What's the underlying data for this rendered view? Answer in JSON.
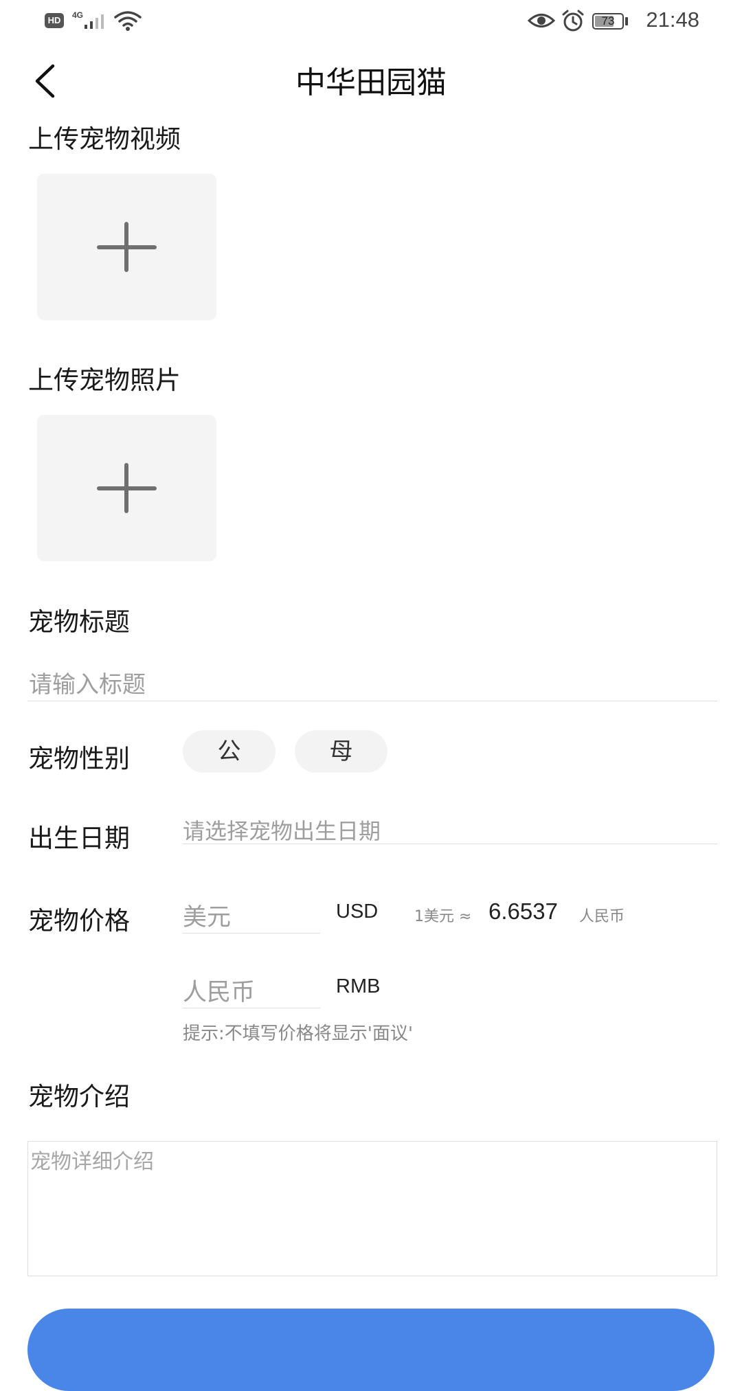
{
  "status_bar": {
    "hd": "HD",
    "network": "4G",
    "battery": "73",
    "battery_level": 0.73,
    "time": "21:48",
    "icons": [
      "hd-icon",
      "signal-icon",
      "wifi-icon",
      "eye-icon",
      "alarm-icon",
      "battery-icon"
    ]
  },
  "header": {
    "title": "中华田园猫",
    "back_icon": "chevron-left-icon"
  },
  "video_section": {
    "label": "上传宠物视频",
    "add_icon": "plus-icon"
  },
  "photo_section": {
    "label": "上传宠物照片",
    "add_icon": "plus-icon"
  },
  "title_field": {
    "label": "宠物标题",
    "placeholder": "请输入标题"
  },
  "gender": {
    "label": "宠物性别",
    "options": [
      "公",
      "母"
    ]
  },
  "birthday": {
    "label": "出生日期",
    "placeholder": "请选择宠物出生日期"
  },
  "price": {
    "label": "宠物价格",
    "usd_placeholder": "美元",
    "usd_code": "USD",
    "rate_prefix": "1美元 ≈",
    "rate_value": "6.6537",
    "rate_suffix": "人民币",
    "rmb_placeholder": "人民币",
    "rmb_code": "RMB",
    "tip": "提示:不填写价格将显示'面议'"
  },
  "intro": {
    "label": "宠物介绍",
    "placeholder": "宠物详细介绍"
  },
  "colors": {
    "accent": "#4a86e8",
    "upload_bg": "#f4f4f4",
    "placeholder": "#9e9e9e"
  }
}
